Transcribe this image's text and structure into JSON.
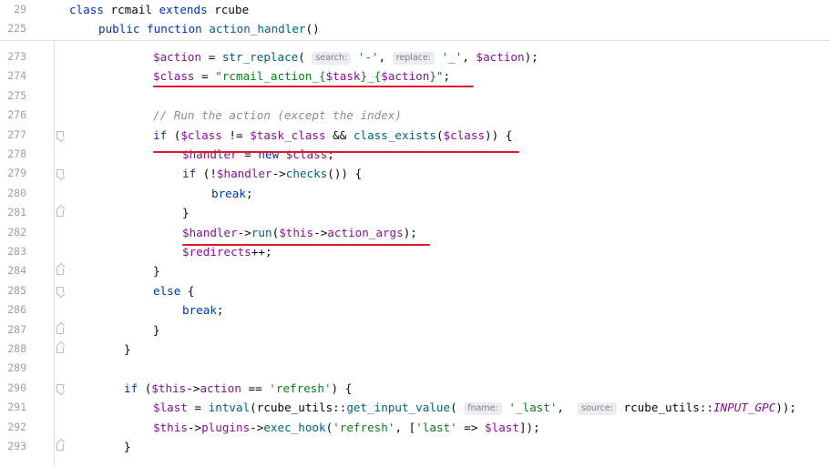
{
  "editor": {
    "breadcrumb": [
      {
        "line": "29",
        "tokens": [
          [
            "kw",
            "class "
          ],
          [
            "",
            "rcmail "
          ],
          [
            "kw",
            "extends "
          ],
          [
            "",
            "rcube"
          ]
        ]
      },
      {
        "line": "225",
        "tokens": [
          [
            "kw",
            "public function "
          ],
          [
            "fn",
            "action_handler"
          ],
          [
            "",
            "()"
          ]
        ]
      }
    ],
    "lines": [
      {
        "line": "273",
        "tokens": [
          [
            "vr",
            "$action"
          ],
          [
            "",
            " = "
          ],
          [
            "fn",
            "str_replace"
          ],
          [
            "",
            "( "
          ],
          [
            "hint",
            "search:"
          ],
          [
            "",
            " "
          ],
          [
            "st",
            "'-'"
          ],
          [
            "",
            ", "
          ],
          [
            "hint",
            "replace:"
          ],
          [
            "",
            " "
          ],
          [
            "st",
            "'_'"
          ],
          [
            "",
            ", "
          ],
          [
            "vr",
            "$action"
          ],
          [
            "",
            ");"
          ]
        ]
      },
      {
        "line": "274",
        "tokens": [
          [
            "vr",
            "$class"
          ],
          [
            "",
            " = "
          ],
          [
            "st",
            "\"rcmail_action_{"
          ],
          [
            "vr",
            "$task"
          ],
          [
            "st",
            "}_{"
          ],
          [
            "vr",
            "$action"
          ],
          [
            "st",
            "}\""
          ],
          [
            "",
            ";"
          ]
        ]
      },
      {
        "line": "275",
        "tokens": []
      },
      {
        "line": "276",
        "tokens": [
          [
            "cm",
            "// Run the action (except the index)"
          ]
        ]
      },
      {
        "line": "277",
        "fold": "open",
        "tokens": [
          [
            "kw",
            "if "
          ],
          [
            "",
            "("
          ],
          [
            "vr",
            "$class"
          ],
          [
            "",
            " != "
          ],
          [
            "vr",
            "$task_class"
          ],
          [
            "",
            " && "
          ],
          [
            "fn",
            "class_exists"
          ],
          [
            "",
            "("
          ],
          [
            "vr",
            "$class"
          ],
          [
            "",
            ")) {"
          ]
        ]
      },
      {
        "line": "278",
        "tokens": [
          [
            "vr",
            "$handler"
          ],
          [
            "",
            " = "
          ],
          [
            "kw",
            "new "
          ],
          [
            "vr",
            "$class"
          ],
          [
            "",
            ";"
          ]
        ]
      },
      {
        "line": "279",
        "fold": "open",
        "tokens": [
          [
            "kw",
            "if "
          ],
          [
            "",
            "(!"
          ],
          [
            "vr",
            "$handler"
          ],
          [
            "",
            "->"
          ],
          [
            "fn",
            "checks"
          ],
          [
            "",
            "()) {"
          ]
        ]
      },
      {
        "line": "280",
        "tokens": [
          [
            "kw",
            "break"
          ],
          [
            "",
            ";"
          ]
        ]
      },
      {
        "line": "281",
        "fold": "close",
        "tokens": [
          [
            "",
            "}"
          ]
        ]
      },
      {
        "line": "282",
        "tokens": [
          [
            "vr",
            "$handler"
          ],
          [
            "",
            "->"
          ],
          [
            "fn",
            "run"
          ],
          [
            "",
            "("
          ],
          [
            "vr",
            "$this"
          ],
          [
            "",
            "->"
          ],
          [
            "vr",
            "action_args"
          ],
          [
            "",
            ");"
          ]
        ]
      },
      {
        "line": "283",
        "tokens": [
          [
            "vr",
            "$redirects"
          ],
          [
            "",
            "++;"
          ]
        ]
      },
      {
        "line": "284",
        "fold": "close",
        "tokens": [
          [
            "",
            "}"
          ]
        ]
      },
      {
        "line": "285",
        "fold": "open",
        "tokens": [
          [
            "kw",
            "else "
          ],
          [
            "",
            "{"
          ]
        ]
      },
      {
        "line": "286",
        "tokens": [
          [
            "kw",
            "break"
          ],
          [
            "",
            ";"
          ]
        ]
      },
      {
        "line": "287",
        "fold": "close",
        "tokens": [
          [
            "",
            "}"
          ]
        ]
      },
      {
        "line": "288",
        "fold": "close",
        "tokens": [
          [
            "",
            "}"
          ]
        ]
      },
      {
        "line": "289",
        "tokens": []
      },
      {
        "line": "290",
        "fold": "open",
        "tokens": [
          [
            "kw",
            "if "
          ],
          [
            "",
            "("
          ],
          [
            "vr",
            "$this"
          ],
          [
            "",
            "->"
          ],
          [
            "vr",
            "action"
          ],
          [
            "",
            " == "
          ],
          [
            "st",
            "'refresh'"
          ],
          [
            "",
            ") {"
          ]
        ]
      },
      {
        "line": "291",
        "tokens": [
          [
            "vr",
            "$last"
          ],
          [
            "",
            " = "
          ],
          [
            "fn",
            "intval"
          ],
          [
            "",
            "(rcube_utils::"
          ],
          [
            "fn",
            "get_input_value"
          ],
          [
            "",
            "( "
          ],
          [
            "hint",
            "fname:"
          ],
          [
            "",
            " "
          ],
          [
            "st",
            "'_last'"
          ],
          [
            "",
            ",  "
          ],
          [
            "hint",
            "source:"
          ],
          [
            "",
            " rcube_utils::"
          ],
          [
            "cst",
            "INPUT_GPC"
          ],
          [
            "",
            "));"
          ]
        ]
      },
      {
        "line": "292",
        "tokens": [
          [
            "vr",
            "$this"
          ],
          [
            "",
            "->"
          ],
          [
            "vr",
            "plugins"
          ],
          [
            "",
            "->"
          ],
          [
            "fn",
            "exec_hook"
          ],
          [
            "",
            "("
          ],
          [
            "st",
            "'refresh'"
          ],
          [
            "",
            ", ["
          ],
          [
            "st",
            "'last'"
          ],
          [
            "",
            " => "
          ],
          [
            "vr",
            "$last"
          ],
          [
            "",
            "]);"
          ]
        ]
      },
      {
        "line": "293",
        "fold": "close",
        "tokens": [
          [
            "",
            "}"
          ]
        ]
      }
    ]
  },
  "colors": {
    "keyword": "#0033b3",
    "variable": "#871094",
    "string": "#067d17",
    "function": "#00627a",
    "comment": "#8c8c8c",
    "annotation": "#e0182a"
  }
}
